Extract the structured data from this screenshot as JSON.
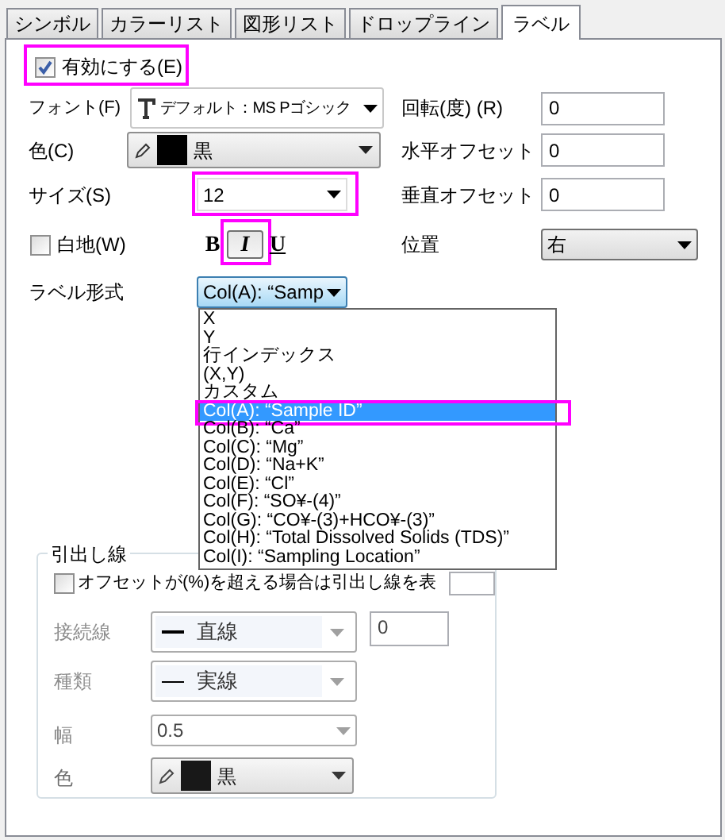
{
  "tabs": [
    {
      "label": "シンボル",
      "selected": false
    },
    {
      "label": "カラーリスト",
      "selected": false
    },
    {
      "label": "図形リスト",
      "selected": false
    },
    {
      "label": "ドロップライン",
      "selected": false
    },
    {
      "label": "ラベル",
      "selected": true
    }
  ],
  "enable": {
    "label": "有効にする(E)",
    "checked": true,
    "highlighted": true
  },
  "font": {
    "label": "フォント(F)",
    "value": "デフォルト：MS Pゴシック"
  },
  "color": {
    "label": "色(C)",
    "value": "黒"
  },
  "size": {
    "label": "サイズ(S)",
    "value": "12",
    "highlighted": true
  },
  "rotation": {
    "label": "回転(度) (R)",
    "value": "0"
  },
  "h_offset": {
    "label": "水平オフセット",
    "value": "0"
  },
  "v_offset": {
    "label": "垂直オフセット",
    "value": "0"
  },
  "white_bg": {
    "label": "白地(W)",
    "checked": false
  },
  "style_buttons": [
    {
      "label": "B",
      "kind": "bold",
      "pressed": false,
      "highlighted": false
    },
    {
      "label": "I",
      "kind": "italic",
      "pressed": true,
      "highlighted": true
    },
    {
      "label": "U",
      "kind": "underline",
      "pressed": false,
      "highlighted": false
    }
  ],
  "position": {
    "label": "位置",
    "value": "右"
  },
  "label_format": {
    "label": "ラベル形式",
    "value": "Col(A): “Samp",
    "options": [
      {
        "text": "X",
        "selected": false,
        "highlighted": false
      },
      {
        "text": "Y",
        "selected": false,
        "highlighted": false
      },
      {
        "text": "行インデックス",
        "selected": false,
        "highlighted": false
      },
      {
        "text": "(X,Y)",
        "selected": false,
        "highlighted": false
      },
      {
        "text": "カスタム",
        "selected": false,
        "highlighted": false
      },
      {
        "text": "Col(A): “Sample ID”",
        "selected": true,
        "highlighted": true
      },
      {
        "text": "Col(B): “Ca”",
        "selected": false,
        "highlighted": false
      },
      {
        "text": "Col(C): “Mg”",
        "selected": false,
        "highlighted": false
      },
      {
        "text": "Col(D): “Na+K”",
        "selected": false,
        "highlighted": false
      },
      {
        "text": "Col(E): “Cl”",
        "selected": false,
        "highlighted": false
      },
      {
        "text": "Col(F): “SO¥-(4)”",
        "selected": false,
        "highlighted": false
      },
      {
        "text": "Col(G): “CO¥-(3)+HCO¥-(3)”",
        "selected": false,
        "highlighted": false
      },
      {
        "text": "Col(H): “Total Dissolved Solids (TDS)”",
        "selected": false,
        "highlighted": false
      },
      {
        "text": "Col(I): “Sampling Location”",
        "selected": false,
        "highlighted": false
      }
    ]
  },
  "leader": {
    "title": "引出し線",
    "offset_option": {
      "label": "オフセットが(%)を超える場合は引出し線を表",
      "checked": false
    },
    "rows": [
      {
        "kind": "line",
        "label": "接続線",
        "value": "直線",
        "extra_value": "0",
        "disabled": true
      },
      {
        "kind": "line",
        "label": "種類",
        "value": "実線",
        "disabled": true
      },
      {
        "kind": "plain",
        "label": "幅",
        "value": "0.5",
        "disabled": true
      },
      {
        "kind": "color",
        "label": "色",
        "value": "黒",
        "disabled": false
      }
    ]
  }
}
